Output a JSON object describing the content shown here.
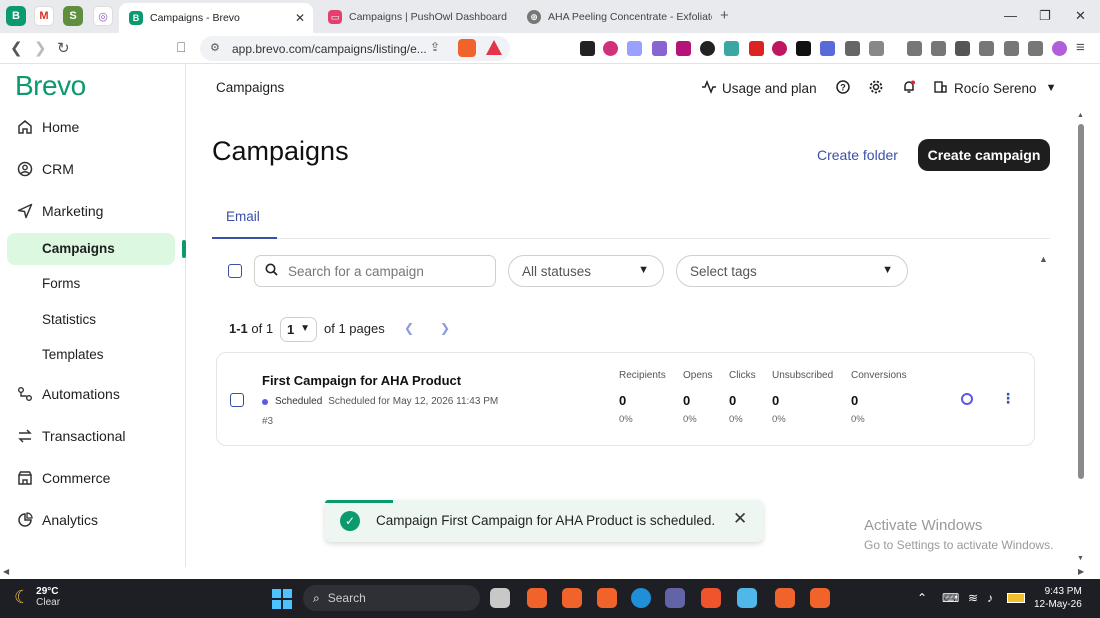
{
  "browser": {
    "tabs": [
      {
        "title": "Campaigns - Brevo",
        "active": true
      },
      {
        "title": "Campaigns | PushOwl Dashboard",
        "active": false
      },
      {
        "title": "AHA Peeling Concentrate - Exfoliate /",
        "active": false
      }
    ],
    "url": "app.brevo.com/campaigns/listing/e..."
  },
  "sidebar": {
    "logo": "Brevo",
    "items": [
      {
        "label": "Home",
        "icon": "home-icon"
      },
      {
        "label": "CRM",
        "icon": "user-circle-icon"
      },
      {
        "label": "Marketing",
        "icon": "send-icon"
      },
      {
        "label": "Automations",
        "icon": "workflow-icon"
      },
      {
        "label": "Transactional",
        "icon": "transfer-icon"
      },
      {
        "label": "Commerce",
        "icon": "store-icon"
      },
      {
        "label": "Analytics",
        "icon": "pie-chart-icon"
      }
    ],
    "marketing_sub": [
      "Campaigns",
      "Forms",
      "Statistics",
      "Templates"
    ]
  },
  "topbar": {
    "section": "Campaigns",
    "usage": "Usage and plan",
    "user": "Rocío Sereno"
  },
  "page": {
    "title": "Campaigns",
    "create_folder": "Create folder",
    "create_campaign": "Create campaign",
    "tab_email": "Email"
  },
  "filters": {
    "search_placeholder": "Search for a campaign",
    "status": "All statuses",
    "tags": "Select tags"
  },
  "pagination": {
    "range": "1-1",
    "of_label": "of 1",
    "page": "1",
    "pages_label": "of 1 pages"
  },
  "campaign": {
    "name": "First Campaign for AHA Product",
    "status": "Scheduled",
    "scheduled_for": "Scheduled for May 12, 2026 11:43 PM",
    "id": "#3",
    "stats": [
      {
        "label": "Recipients",
        "value": "0",
        "pct": "0%"
      },
      {
        "label": "Opens",
        "value": "0",
        "pct": "0%"
      },
      {
        "label": "Clicks",
        "value": "0",
        "pct": "0%"
      },
      {
        "label": "Unsubscribed",
        "value": "0",
        "pct": "0%"
      },
      {
        "label": "Conversions",
        "value": "0",
        "pct": "0%"
      }
    ]
  },
  "toast": {
    "message": "Campaign First Campaign for AHA Product is scheduled."
  },
  "watermark": {
    "line1": "Activate Windows",
    "line2": "Go to Settings to activate Windows."
  },
  "taskbar": {
    "temp": "29°C",
    "condition": "Clear",
    "search": "Search",
    "time": "9:43 PM",
    "date": "12-May-26"
  },
  "colors": {
    "brand_green": "#0b996e",
    "accent_blue": "#3b4fa8",
    "active_bg": "#dcf8e0"
  }
}
